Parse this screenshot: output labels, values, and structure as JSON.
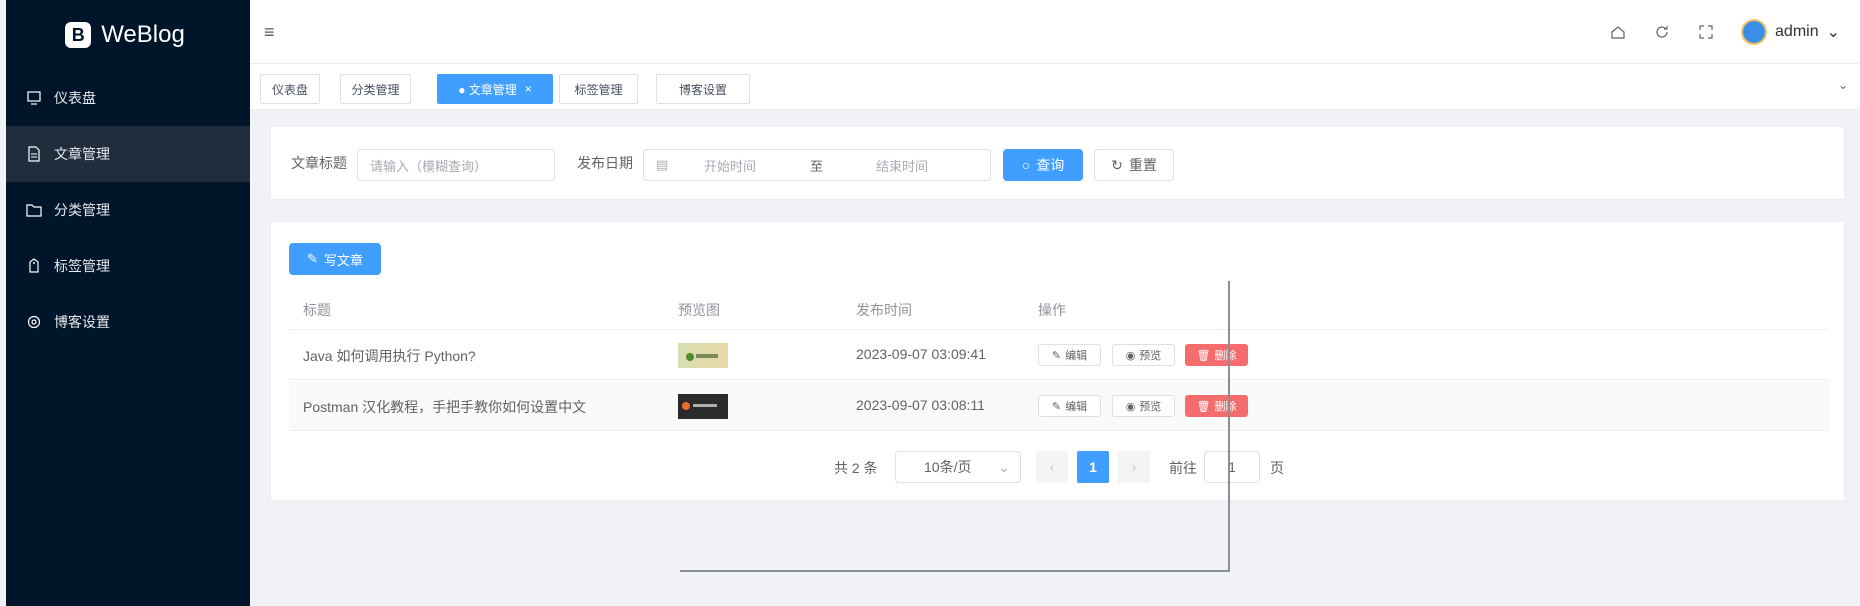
{
  "app": {
    "name": "WeBlog"
  },
  "sidebar": {
    "items": [
      {
        "label": "仪表盘",
        "icon": "monitor-icon"
      },
      {
        "label": "文章管理",
        "icon": "document-icon",
        "active": true
      },
      {
        "label": "分类管理",
        "icon": "folder-icon"
      },
      {
        "label": "标签管理",
        "icon": "tag-icon"
      },
      {
        "label": "博客设置",
        "icon": "gear-icon"
      }
    ]
  },
  "header": {
    "user": "admin"
  },
  "tabs": [
    {
      "label": "仪表盘"
    },
    {
      "label": "分类管理"
    },
    {
      "label": "● 文章管理",
      "active": true,
      "close": "×"
    },
    {
      "label": "标签管理"
    },
    {
      "label": "博客设置"
    }
  ],
  "search": {
    "title_label": "文章标题",
    "title_placeholder": "请输入（模糊查询）",
    "date_label": "发布日期",
    "start_placeholder": "开始时间",
    "range_sep": "至",
    "end_placeholder": "结束时间",
    "query_button": "查询",
    "reset_button": "重置"
  },
  "table": {
    "write_button": "写文章",
    "columns": [
      "标题",
      "预览图",
      "发布时间",
      "操作"
    ],
    "rows": [
      {
        "title": "Java 如何调用执行 Python?",
        "published": "2023-09-07 03:09:41"
      },
      {
        "title": "Postman 汉化教程，手把手教你如何设置中文",
        "published": "2023-09-07 03:08:11"
      }
    ],
    "actions": {
      "edit": "编辑",
      "preview": "预览",
      "delete": "删除"
    }
  },
  "pagination": {
    "total": "共 2 条",
    "page_size": "10条/页",
    "prev": "‹",
    "current": "1",
    "next": "›",
    "goto_label": "前往",
    "goto_value": "1",
    "page_suffix": "页"
  },
  "colors": {
    "sidebar_bg": "#001529",
    "primary": "#409eff",
    "danger": "#f56c6c"
  }
}
